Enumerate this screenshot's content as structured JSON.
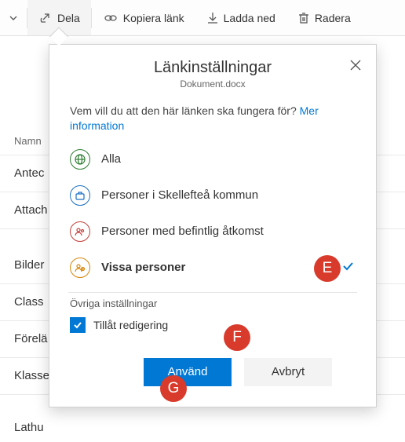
{
  "toolbar": {
    "share": "Dela",
    "copy_link": "Kopiera länk",
    "download": "Ladda ned",
    "delete": "Radera"
  },
  "list": {
    "header_name": "Namn",
    "rows": [
      "Antec",
      "Attach",
      "Bilder",
      "Class",
      "Förelä",
      "Klasse",
      "Lathu"
    ]
  },
  "popover": {
    "title": "Länkinställningar",
    "filename": "Dokument.docx",
    "prompt": "Vem vill du att den här länken ska fungera för?",
    "more_info": "Mer information",
    "options": {
      "all": "Alla",
      "org": "Personer i Skellefteå kommun",
      "existing": "Personer med befintlig åtkomst",
      "specific": "Vissa personer"
    },
    "other_settings": "Övriga inställningar",
    "allow_edit": "Tillåt redigering",
    "apply": "Använd",
    "cancel": "Avbryt"
  },
  "annotations": {
    "e": "E",
    "f": "F",
    "g": "G"
  },
  "colors": {
    "accent": "#0078d4",
    "green": "#2e7d32",
    "blue": "#1a6fc4",
    "red": "#c4403a",
    "orange": "#d8860b"
  }
}
